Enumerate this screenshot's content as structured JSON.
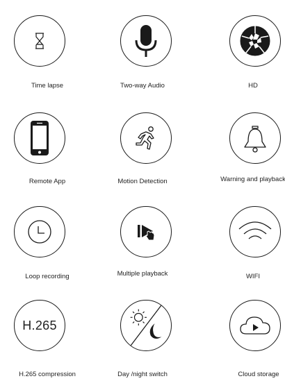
{
  "features": [
    {
      "label": "Time lapse",
      "icon": "hourglass-icon"
    },
    {
      "label": "Two-way Audio",
      "icon": "microphone-icon"
    },
    {
      "label": "HD",
      "icon": "camera-aperture-icon"
    },
    {
      "label": "Remote App",
      "icon": "smartphone-icon"
    },
    {
      "label": "Motion Detection",
      "icon": "running-person-icon"
    },
    {
      "label": "Warning and playback",
      "icon": "bell-icon"
    },
    {
      "label": "Loop recording",
      "icon": "clock-icon"
    },
    {
      "label": "Multiple playback",
      "icon": "play-pointer-icon"
    },
    {
      "label": "WIFI",
      "icon": "wifi-icon"
    },
    {
      "label": "H.265 compression",
      "icon": "h265-icon",
      "icon_text": "H.265"
    },
    {
      "label": "Day /night switch",
      "icon": "sun-moon-icon"
    },
    {
      "label": "Cloud storage",
      "icon": "cloud-play-icon"
    }
  ],
  "colors": {
    "stroke": "#1a1a1a",
    "text": "#222222",
    "background": "#ffffff"
  }
}
